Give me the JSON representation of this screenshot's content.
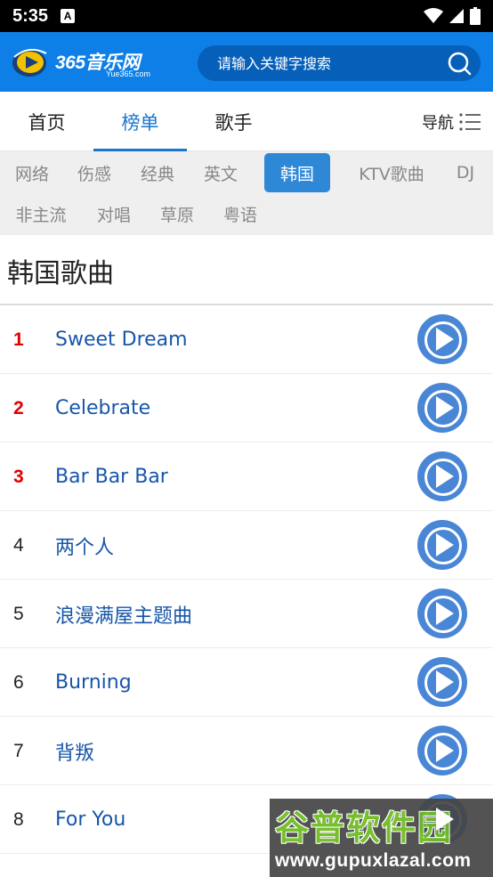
{
  "status_bar": {
    "time": "5:35",
    "notification_letter": "A"
  },
  "header": {
    "logo_text": "365音乐网",
    "logo_sub": "Yue365.com",
    "search_placeholder": "请输入关键字搜索"
  },
  "main_tabs": [
    {
      "label": "首页",
      "active": false
    },
    {
      "label": "榜单",
      "active": true
    },
    {
      "label": "歌手",
      "active": false
    }
  ],
  "nav_label": "导航",
  "categories": [
    {
      "label": "网络",
      "active": false
    },
    {
      "label": "伤感",
      "active": false
    },
    {
      "label": "经典",
      "active": false
    },
    {
      "label": "英文",
      "active": false
    },
    {
      "label": "韩国",
      "active": true
    },
    {
      "label": "KTV歌曲",
      "active": false
    },
    {
      "label": "DJ",
      "active": false
    },
    {
      "label": "非主流",
      "active": false
    },
    {
      "label": "对唱",
      "active": false
    },
    {
      "label": "草原",
      "active": false
    },
    {
      "label": "粤语",
      "active": false
    }
  ],
  "section_title": "韩国歌曲",
  "songs": [
    {
      "rank": "1",
      "name": "Sweet Dream"
    },
    {
      "rank": "2",
      "name": "Celebrate"
    },
    {
      "rank": "3",
      "name": "Bar Bar Bar"
    },
    {
      "rank": "4",
      "name": "两个人"
    },
    {
      "rank": "5",
      "name": "浪漫满屋主题曲"
    },
    {
      "rank": "6",
      "name": "Burning"
    },
    {
      "rank": "7",
      "name": "背叛"
    },
    {
      "rank": "8",
      "name": "For You"
    }
  ],
  "watermark": {
    "title": "谷普软件园",
    "url": "www.gupuxlazal.com"
  },
  "colors": {
    "header_blue": "#0d7fe6",
    "active_blue": "#1976d2",
    "top_rank_red": "#e00000",
    "song_blue": "#1756a9",
    "play_blue": "#4a86d6"
  }
}
